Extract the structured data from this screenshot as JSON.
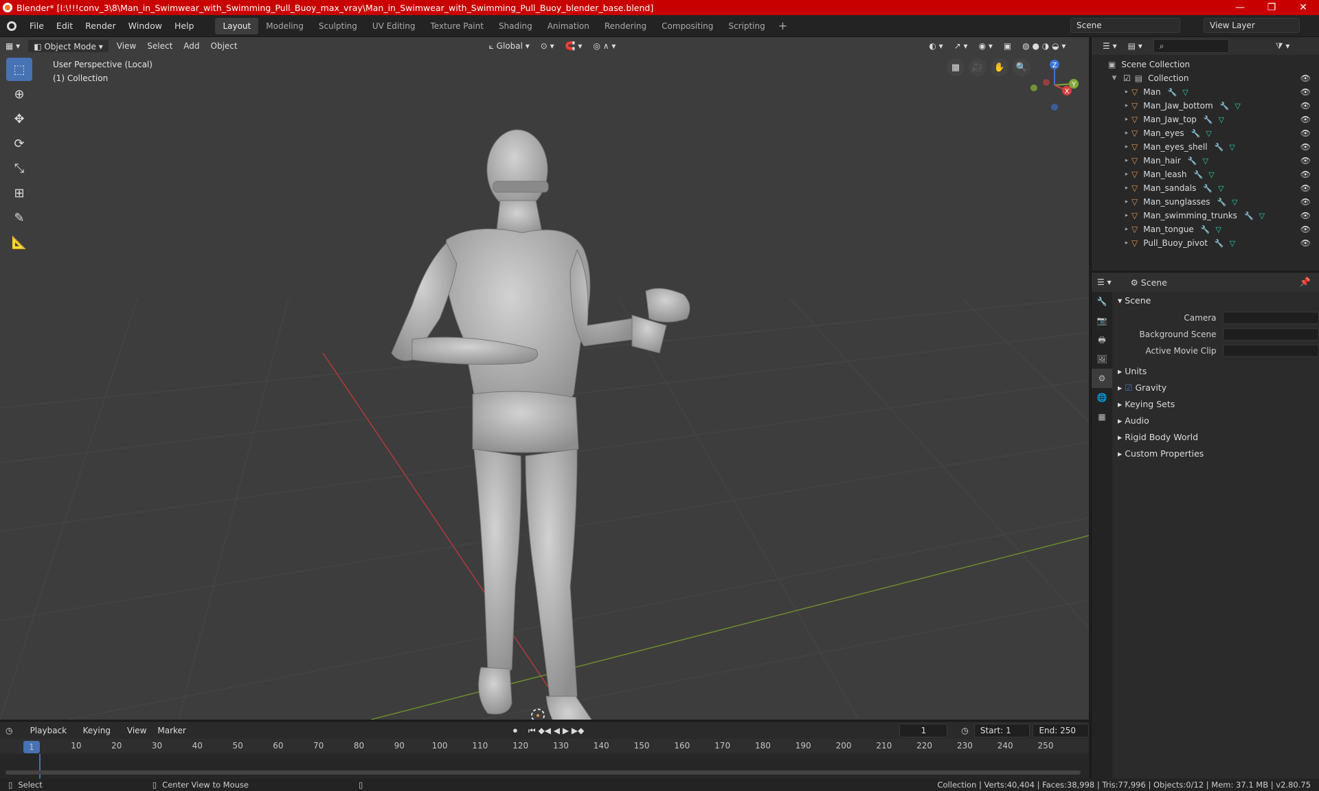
{
  "window": {
    "title": "Blender* [I:\\!!!conv_3\\8\\Man_in_Swimwear_with_Swimming_Pull_Buoy_max_vray\\Man_in_Swimwear_with_Swimming_Pull_Buoy_blender_base.blend]",
    "controls": [
      "—",
      "❐",
      "✕"
    ]
  },
  "menubar": {
    "items": [
      "File",
      "Edit",
      "Render",
      "Window",
      "Help"
    ],
    "workspaces": [
      "Layout",
      "Modeling",
      "Sculpting",
      "UV Editing",
      "Texture Paint",
      "Shading",
      "Animation",
      "Rendering",
      "Compositing",
      "Scripting"
    ],
    "active_workspace": "Layout",
    "scene": "Scene",
    "view_layer": "View Layer"
  },
  "viewport_header": {
    "mode": "Object Mode",
    "menus": [
      "View",
      "Select",
      "Add",
      "Object"
    ],
    "orientation": "Global"
  },
  "viewport": {
    "info_line1": "User Perspective (Local)",
    "info_line2": "(1) Collection",
    "gizmo_axes": [
      "Z",
      "Y",
      "X"
    ]
  },
  "outliner": {
    "root": "Scene Collection",
    "collection": "Collection",
    "objects": [
      "Man",
      "Man_Jaw_bottom",
      "Man_Jaw_top",
      "Man_eyes",
      "Man_eyes_shell",
      "Man_hair",
      "Man_leash",
      "Man_sandals",
      "Man_sunglasses",
      "Man_swimming_trunks",
      "Man_tongue",
      "Pull_Buoy_pivot"
    ]
  },
  "properties": {
    "header": "Scene",
    "panel": "Scene",
    "fields": [
      "Camera",
      "Background Scene",
      "Active Movie Clip"
    ],
    "subpanels": [
      "Units",
      "Gravity",
      "Keying Sets",
      "Audio",
      "Rigid Body World",
      "Custom Properties"
    ],
    "gravity_checked": true
  },
  "timeline": {
    "menus": [
      "Playback",
      "Keying",
      "View",
      "Marker"
    ],
    "current_frame": "1",
    "start_label": "Start:",
    "start": "1",
    "end_label": "End:",
    "end": "250",
    "ruler": [
      "1",
      "10",
      "20",
      "30",
      "40",
      "50",
      "60",
      "70",
      "80",
      "90",
      "100",
      "110",
      "120",
      "130",
      "140",
      "150",
      "160",
      "170",
      "180",
      "190",
      "200",
      "210",
      "220",
      "230",
      "240",
      "250"
    ]
  },
  "statusbar": {
    "left": "Select",
    "middle": "Center View to Mouse",
    "right": "Collection | Verts:40,404 | Faces:38,998 | Tris:77,996 | Objects:0/12 | Mem: 37.1 MB | v2.80.75"
  }
}
